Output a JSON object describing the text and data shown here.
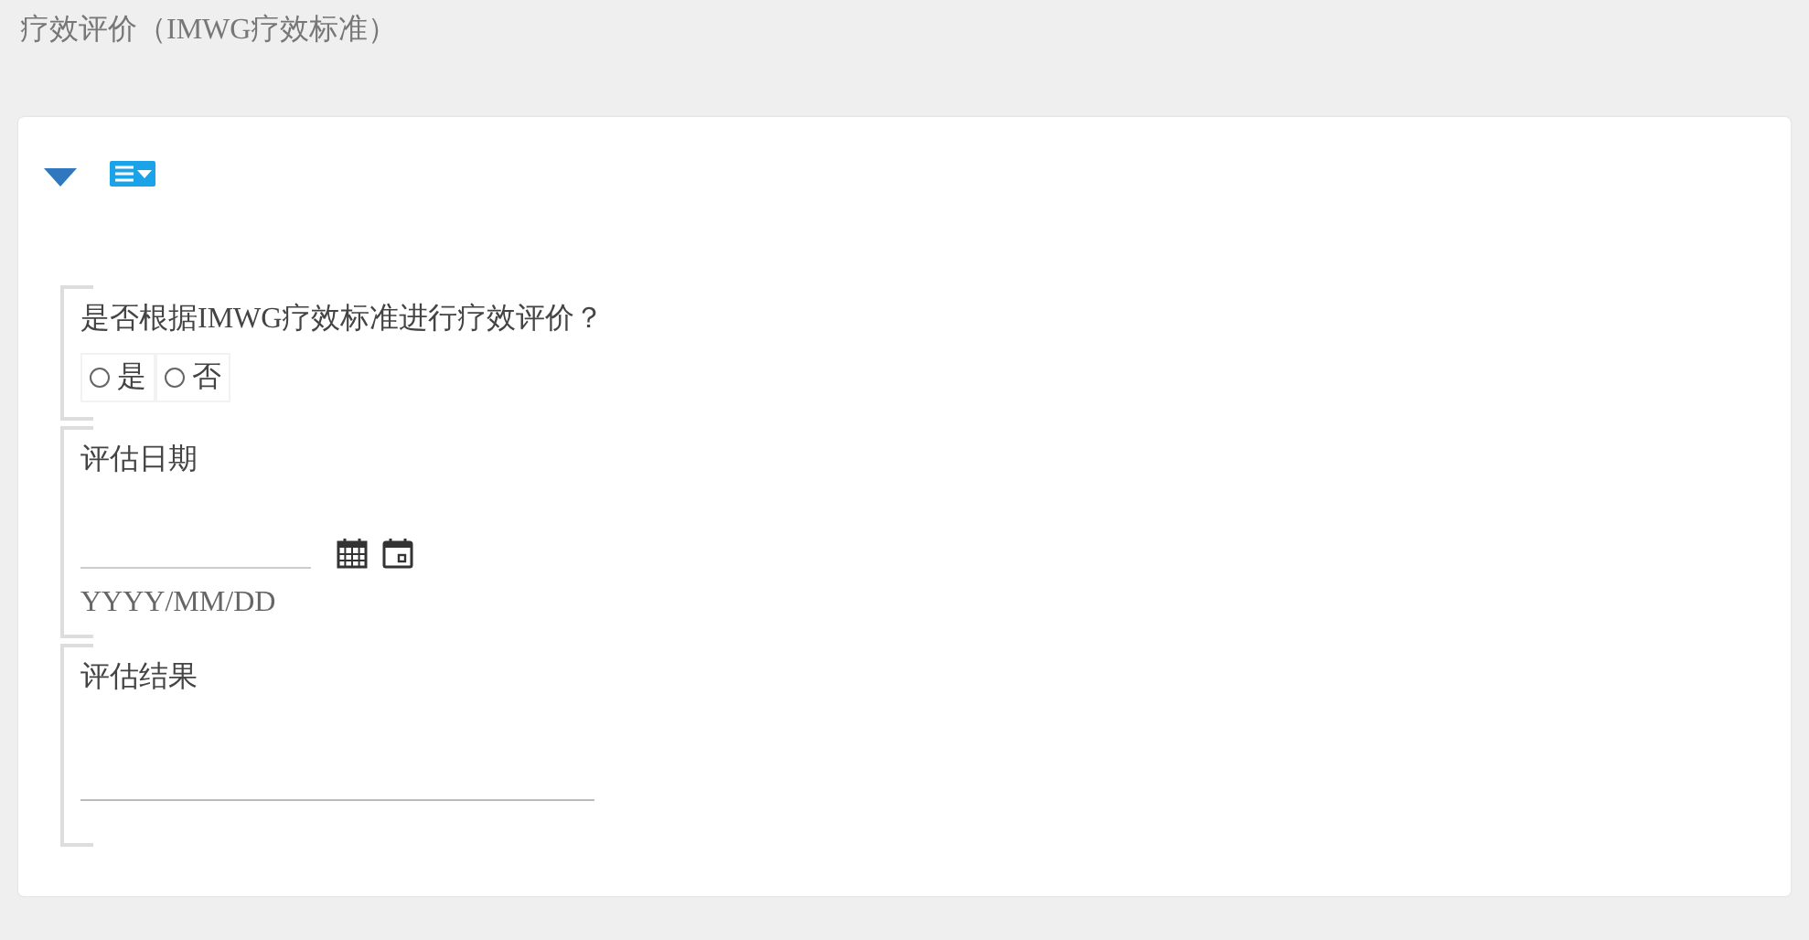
{
  "page_title": "疗效评价（IMWG疗效标准）",
  "panel": {
    "expanded": true
  },
  "sections": [
    {
      "kind": "radio",
      "label": "是否根据IMWG疗效标准进行疗效评价？",
      "options": [
        {
          "label": "是",
          "selected": false
        },
        {
          "label": "否",
          "selected": false
        }
      ]
    },
    {
      "kind": "date",
      "label": "评估日期",
      "hint": "YYYY/MM/DD"
    },
    {
      "kind": "text",
      "label": "评估结果"
    }
  ]
}
